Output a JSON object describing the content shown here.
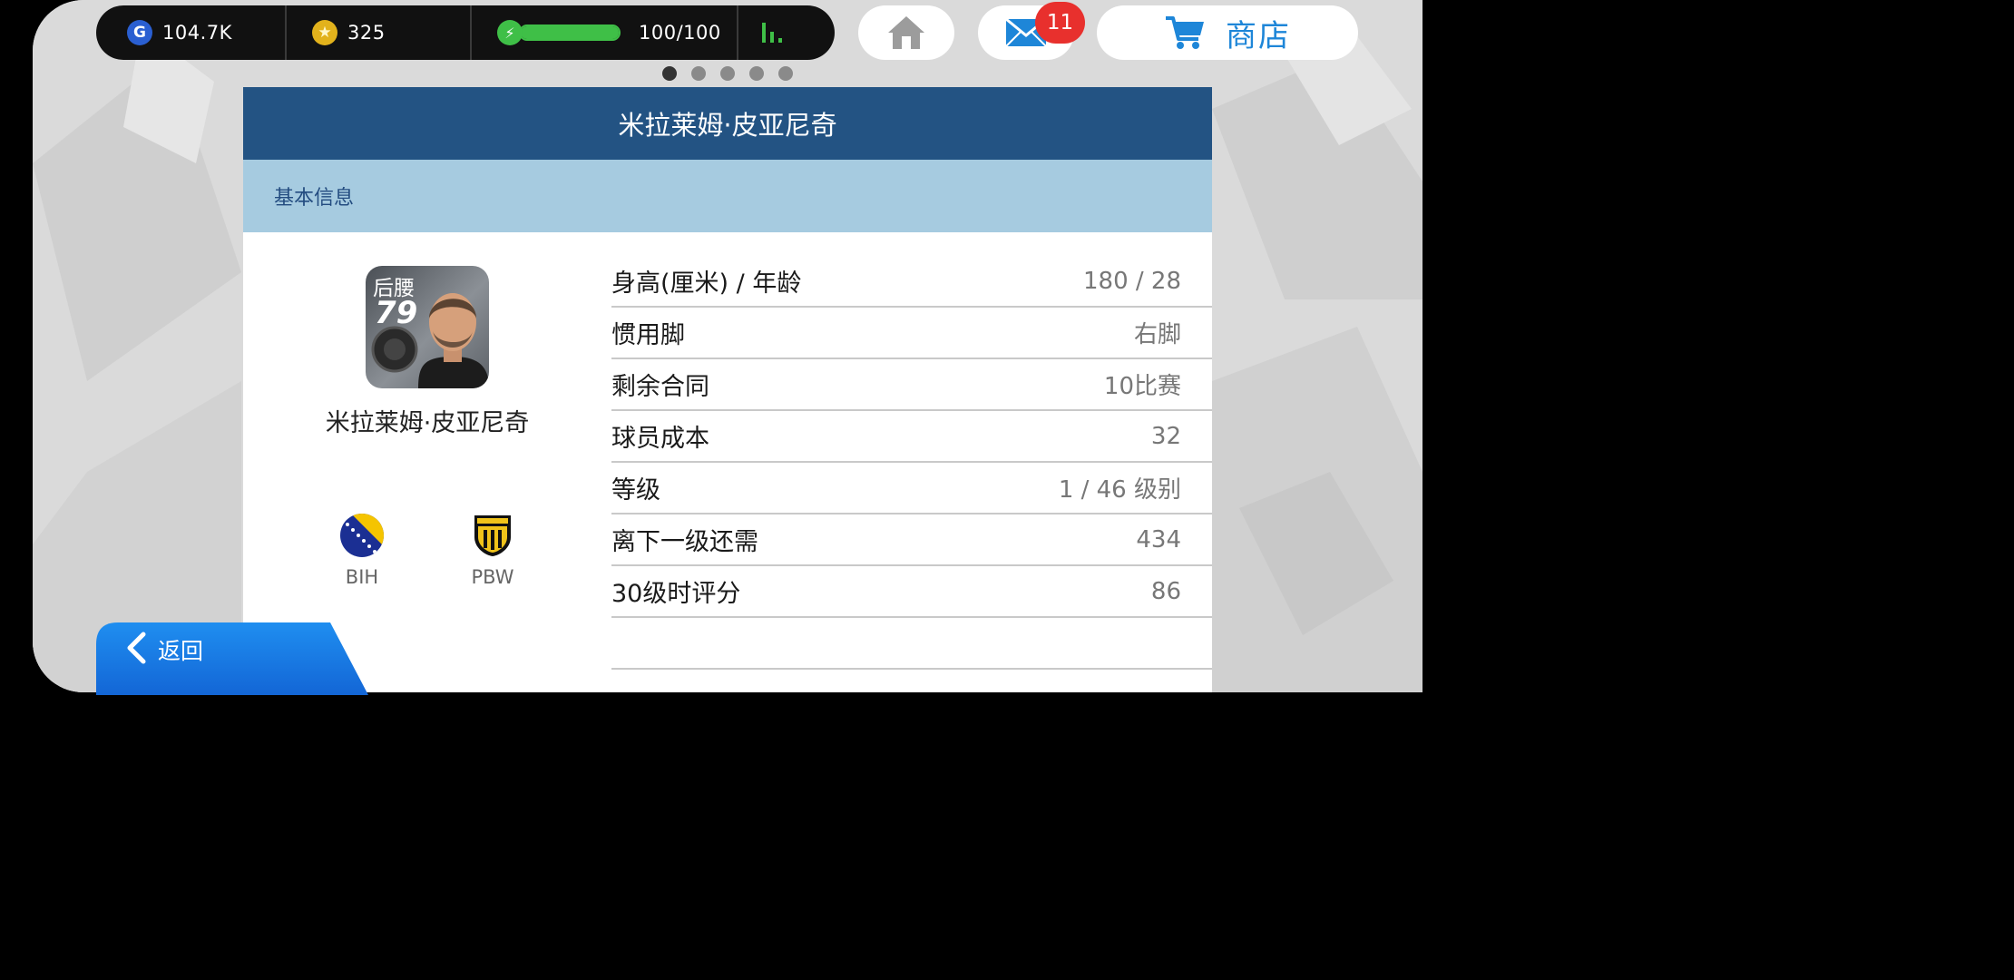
{
  "resources": {
    "gp": {
      "icon": "gp-coin-icon",
      "value": "104.7K"
    },
    "coins": {
      "icon": "gold-coin-icon",
      "value": "325"
    },
    "energy": {
      "icon": "energy-icon",
      "value": "100/100",
      "fill_fraction": 1.0
    },
    "signal": {
      "icon": "signal-icon"
    }
  },
  "nav": {
    "home_icon": "home-icon",
    "mail_icon": "mail-icon",
    "mail_badge": "11",
    "shop_icon": "cart-icon",
    "shop_label": "商店"
  },
  "pagination": {
    "total": 5,
    "active": 1
  },
  "panel": {
    "title": "米拉莱姆·皮亚尼奇",
    "section": "基本信息"
  },
  "player": {
    "position": "后腰",
    "rating": "79",
    "name": "米拉莱姆·皮亚尼奇",
    "nation_code": "BIH",
    "club_code": "PBW"
  },
  "stats": [
    {
      "label": "身高(厘米) / 年龄",
      "value": "180 / 28"
    },
    {
      "label": "惯用脚",
      "value": "右脚"
    },
    {
      "label": "剩余合同",
      "value": "10比赛"
    },
    {
      "label": "球员成本",
      "value": "32"
    },
    {
      "label": "等级",
      "value": "1 / 46 级别"
    },
    {
      "label": "离下一级还需",
      "value": "434"
    },
    {
      "label": "30级时评分",
      "value": "86"
    }
  ],
  "back": {
    "label": "返回"
  },
  "colors": {
    "header_blue": "#235383",
    "section_blue": "#a6cbe0",
    "accent_blue": "#1e86d8",
    "badge_red": "#e8302d",
    "energy_green": "#3fbf47"
  }
}
